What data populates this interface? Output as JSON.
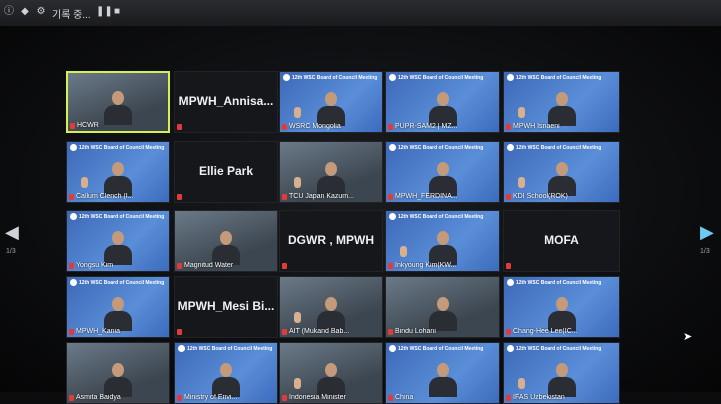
{
  "topbar": {
    "title": "기록 중...",
    "icons": [
      "info-icon",
      "shield-icon",
      "gear-icon",
      "pause-icon",
      "stop-icon"
    ]
  },
  "pager": {
    "left": "1/3",
    "right": "1/3"
  },
  "slide_header": "12th WSC Board of Council Meeting",
  "tiles": [
    {
      "id": "hcwr",
      "caption": "HCWR",
      "kind": "photo",
      "active": true
    },
    {
      "id": "annisa",
      "big": "MPWH_Annisa...",
      "caption": "",
      "kind": "name-only"
    },
    {
      "id": "mongolia",
      "caption": "WSRC Mongolia",
      "kind": "slide",
      "hand": true
    },
    {
      "id": "pupr",
      "caption": "PUPR-SAM2 | MZ...",
      "kind": "slide"
    },
    {
      "id": "isnaeni",
      "caption": "MPWH Isnaeni",
      "kind": "slide",
      "hand": true
    },
    {
      "id": "callum",
      "caption": "Callum Clench (I...",
      "kind": "slide",
      "hand": true
    },
    {
      "id": "ellie",
      "big": "Ellie Park",
      "caption": "",
      "kind": "name-only"
    },
    {
      "id": "tcu",
      "caption": "TCU Japan Kazum...",
      "kind": "photo",
      "hand": true
    },
    {
      "id": "ferdina",
      "caption": "MPWH_FERDINA...",
      "kind": "slide"
    },
    {
      "id": "kdi",
      "caption": "KDI School(ROK)",
      "kind": "slide",
      "hand": true
    },
    {
      "id": "yongsu",
      "caption": "Yongsu Kim",
      "kind": "slide"
    },
    {
      "id": "magnitud",
      "caption": "Magnitud Water",
      "kind": "photo"
    },
    {
      "id": "dgwr",
      "big": "DGWR , MPWH",
      "caption": "",
      "kind": "name-only"
    },
    {
      "id": "inkyoung",
      "caption": "Inkyoung Kim(KW...",
      "kind": "slide",
      "hand": true
    },
    {
      "id": "mofa",
      "big": "MOFA",
      "caption": "",
      "kind": "name-only"
    },
    {
      "id": "kania",
      "caption": "MPWH_Kania",
      "kind": "slide"
    },
    {
      "id": "mesi",
      "big": "MPWH_Mesi Bi...",
      "caption": "",
      "kind": "name-only"
    },
    {
      "id": "ait",
      "caption": "AIT (Mukand Bab...",
      "kind": "photo",
      "hand": true
    },
    {
      "id": "bindu",
      "caption": "Bindu Lohani",
      "kind": "photo"
    },
    {
      "id": "changhee",
      "caption": "Chang-Hee Lee(IC...",
      "kind": "slide"
    },
    {
      "id": "asmita",
      "caption": "Asmita Baidya",
      "kind": "photo"
    },
    {
      "id": "ministry",
      "caption": "Ministry of Envi...",
      "kind": "slide"
    },
    {
      "id": "indonesia",
      "caption": "Indonesia Minister",
      "kind": "photo",
      "hand": true
    },
    {
      "id": "china",
      "caption": "China",
      "kind": "slide"
    },
    {
      "id": "ifas",
      "caption": "IFAS Uzbekistan",
      "kind": "slide",
      "hand": true
    }
  ]
}
